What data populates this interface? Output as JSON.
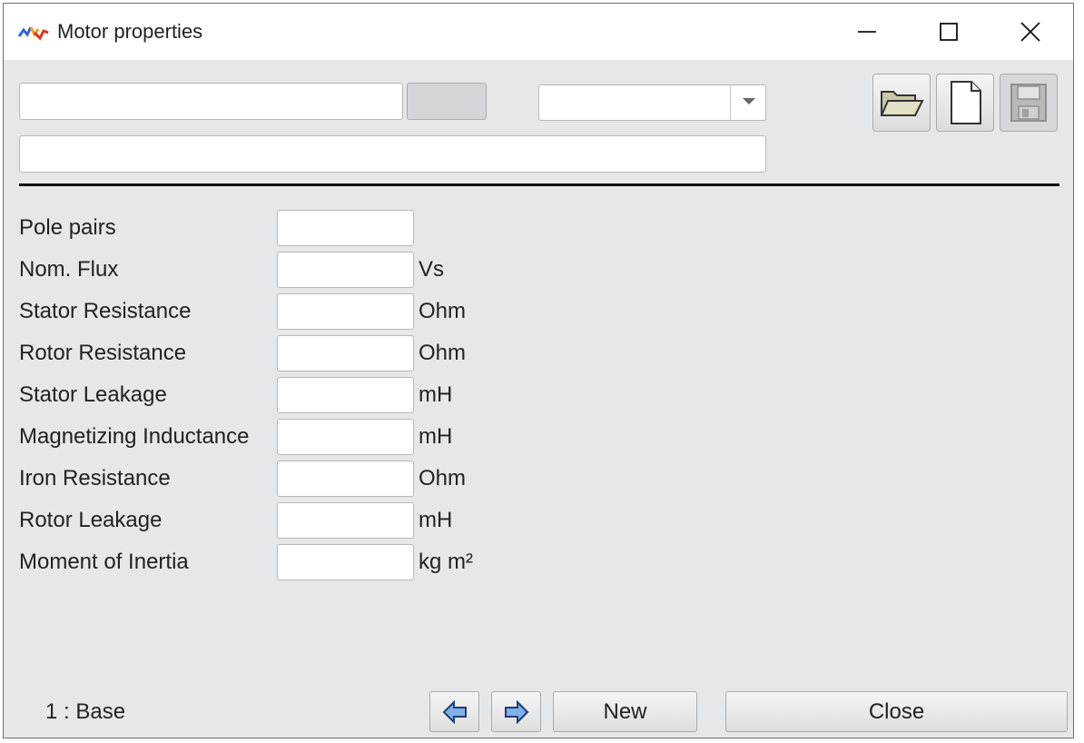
{
  "window": {
    "title": "Motor properties"
  },
  "toolbar": {
    "name_value": "",
    "description_value": "",
    "selector_value": "",
    "icons": [
      "folder-open-icon",
      "new-file-icon",
      "save-icon"
    ]
  },
  "properties": [
    {
      "label": "Pole pairs",
      "value": "",
      "unit": ""
    },
    {
      "label": "Nom. Flux",
      "value": "",
      "unit": "Vs"
    },
    {
      "label": "Stator Resistance",
      "value": "",
      "unit": "Ohm"
    },
    {
      "label": "Rotor Resistance",
      "value": "",
      "unit": "Ohm"
    },
    {
      "label": "Stator Leakage",
      "value": "",
      "unit": "mH"
    },
    {
      "label": "Magnetizing Inductance",
      "value": "",
      "unit": "mH"
    },
    {
      "label": "Iron Resistance",
      "value": "",
      "unit": "Ohm"
    },
    {
      "label": "Rotor Leakage",
      "value": "",
      "unit": "mH"
    },
    {
      "label": "Moment of Inertia",
      "value": "",
      "unit": "kg m²"
    }
  ],
  "footer": {
    "status": "1 : Base",
    "prev_icon": "arrow-left-icon",
    "next_icon": "arrow-right-icon",
    "new_label": "New",
    "close_label": "Close"
  },
  "colors": {
    "window_bg": "#e6e7e9",
    "titlebar_bg": "#ffffff",
    "icon_blue": "#2d64d8",
    "icon_red": "#e03020",
    "icon_orange": "#f0a020"
  }
}
